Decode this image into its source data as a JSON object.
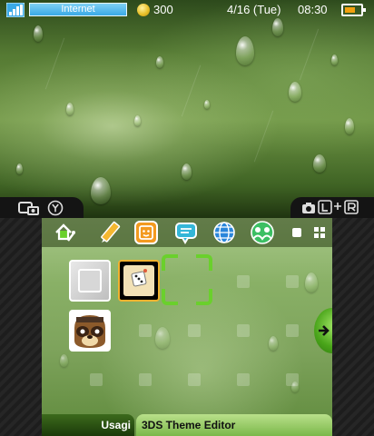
{
  "status": {
    "connection": "Internet",
    "coins": "300",
    "date": "4/16 (Tue)",
    "time": "08:30",
    "battery_level": 0.7,
    "signal_bars": 4
  },
  "camera_tabs": {
    "left_buttons": [
      "screenshot-icon",
      "y-button-icon"
    ],
    "right_buttons": [
      "camera-icon",
      "l-button-icon",
      "r-button-icon"
    ]
  },
  "header_icons": [
    "home-settings-icon",
    "pencil-icon",
    "mii-face-icon",
    "notifications-icon",
    "internet-browser-icon",
    "friends-list-icon"
  ],
  "view_controls": [
    "small-view-icon",
    "grid-view-icon"
  ],
  "apps": [
    {
      "name": "blank-app-icon"
    },
    {
      "name": "dice-app-icon"
    },
    {
      "name": "tanuki-app-icon"
    }
  ],
  "footer": {
    "user_name": "Usagi",
    "selected_title": "3DS Theme Editor"
  },
  "colors": {
    "accent": "#6ad02c",
    "internet": "#3aa9e6",
    "battery": "#f2a10f"
  }
}
